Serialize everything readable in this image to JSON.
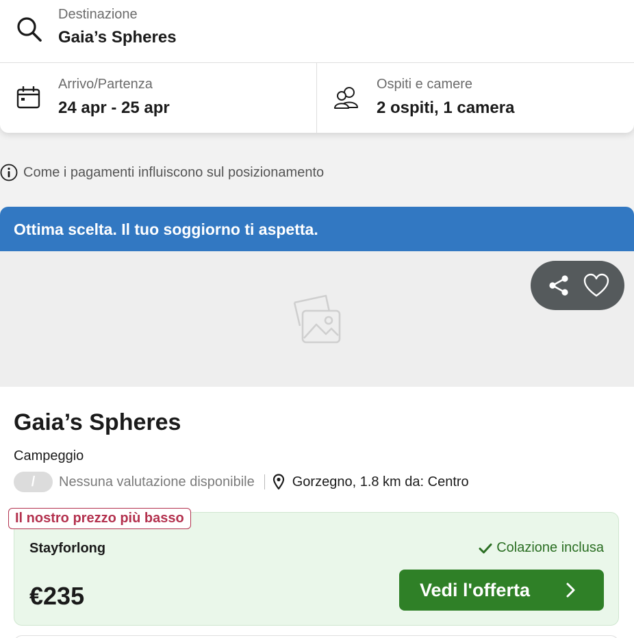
{
  "search": {
    "destination_label": "Destinazione",
    "destination_value": "Gaia’s Spheres",
    "dates_label": "Arrivo/Partenza",
    "dates_value": "24 apr - 25 apr",
    "guests_label": "Ospiti e camere",
    "guests_value": "2 ospiti, 1 camera"
  },
  "info_text": "Come i pagamenti influiscono sul posizionamento",
  "banner": {
    "text": "Ottima scelta. Il tuo soggiorno ti aspetta."
  },
  "actions": {
    "share_icon": "share-icon",
    "favorite_icon": "heart-icon"
  },
  "hotel": {
    "name": "Gaia’s Spheres",
    "type": "Campeggio",
    "rating_badge": "/",
    "rating_text": "Nessuna valutazione disponibile",
    "location": "Gorzegno, 1.8 km da: Centro"
  },
  "deal": {
    "badge": "Il nostro prezzo più basso",
    "provider": "Stayforlong",
    "amenity": "Colazione inclusa",
    "price": "€235",
    "cta": "Vedi l'offerta"
  },
  "colors": {
    "banner": "#3278c2",
    "cta": "#2f8027",
    "deal_bg": "#eaf7ea",
    "badge": "#b3314e"
  }
}
